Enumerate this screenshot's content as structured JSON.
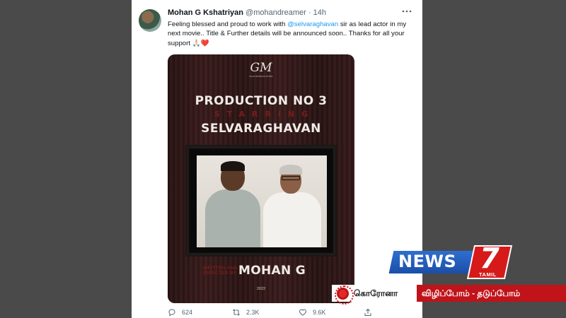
{
  "tweet": {
    "author_name": "Mohan G Kshatriyan",
    "handle": "@mohandreamer",
    "separator": "·",
    "time": "14h",
    "more_icon": "more-icon",
    "text_before": "Feeling blessed and proud to work with ",
    "mention": "@selvaraghavan",
    "text_after": " sir as lead actor in my next movie.. Title & Further details will be announced soon.. Thanks for all your support 🙏🏻❤️"
  },
  "poster": {
    "logo_mark": "GM",
    "logo_sub": "FILM PRODUCTIONS",
    "line1": "PRODUCTION NO 3",
    "line2": "STARRING",
    "line3": "SELVARAGHAVAN",
    "credit_small": "WRITTEN AND DIRECTED BY",
    "credit_name": "MOHAN G",
    "year": "2022"
  },
  "actions": {
    "reply_count": "624",
    "retweet_count": "2.3K",
    "like_count": "9.6K"
  },
  "overlay": {
    "channel_name": "NEWS",
    "channel_number": "7",
    "channel_sub": "TAMIL",
    "ticker_tag": "கொரோனா",
    "ticker_text": "விழிப்போம் - தடுப்போம்",
    "brand_blue": "#1b4fa8",
    "brand_red": "#c0131a"
  }
}
